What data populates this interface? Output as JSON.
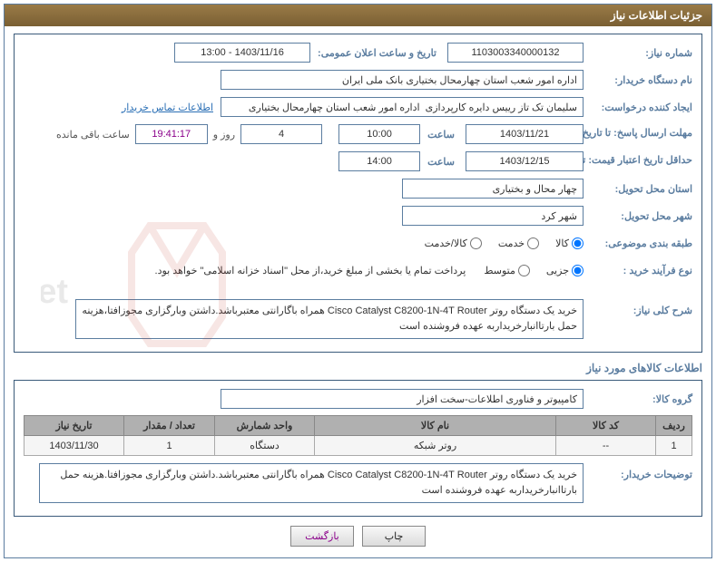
{
  "header_title": "جزئیات اطلاعات نیاز",
  "fields": {
    "need_no_label": "شماره نیاز:",
    "need_no_value": "1103003340000132",
    "announce_label": "تاریخ و ساعت اعلان عمومی:",
    "announce_value": "1403/11/16 - 13:00",
    "buyer_org_label": "نام دستگاه خریدار:",
    "buyer_org_value": "اداره امور شعب استان چهارمحال بختیاری بانک ملی ایران",
    "requester_label": "ایجاد کننده درخواست:",
    "requester_value": "سلیمان تک تاز رییس دایره کارپردازی  اداره امور شعب استان چهارمحال بختیاری",
    "contact_link": "اطلاعات تماس خریدار",
    "response_deadline_label": "مهلت ارسال پاسخ: تا تاریخ:",
    "response_deadline_date": "1403/11/21",
    "saat_label": "ساعت",
    "response_deadline_time": "10:00",
    "days_remaining_value": "4",
    "rooz_va": "روز و",
    "time_remaining_value": "19:41:17",
    "remaining_suffix": "ساعت باقی مانده",
    "price_validity_label": "حداقل تاریخ اعتبار قیمت: تا تاریخ:",
    "price_validity_date": "1403/12/15",
    "price_validity_time": "14:00",
    "delivery_province_label": "استان محل تحویل:",
    "delivery_province_value": "چهار محال و بختیاری",
    "delivery_city_label": "شهر محل تحویل:",
    "delivery_city_value": "شهر کرد",
    "category_label": "طبقه بندی موضوعی:",
    "cat_kala": "کالا",
    "cat_khadamat": "خدمت",
    "cat_kala_khadamat": "کالا/خدمت",
    "process_label": "نوع فرآیند خرید :",
    "proc_jozei": "جزیی",
    "proc_motevaset": "متوسط",
    "payment_note": "پرداخت تمام یا بخشی از مبلغ خرید،از محل \"اسناد خزانه اسلامی\" خواهد بود.",
    "summary_label": "شرح کلی نیاز:",
    "summary_value": "خرید یک دستگاه روتر Cisco Catalyst C8200-1N-4T Router همراه باگارانتی معتبرباشد.داشتن وبارگزاری مجوزافتا،هزینه حمل بارتاانبارخریداربه عهده فروشنده است",
    "goods_info_title": "اطلاعات کالاهای مورد نیاز",
    "group_label": "گروه کالا:",
    "group_value": "کامپیوتر و فناوری اطلاعات-سخت افزار",
    "buyer_desc_label": "توضیحات خریدار:",
    "buyer_desc_value": "خرید یک دستگاه روتر Cisco Catalyst C8200-1N-4T Router همراه باگارانتی معتبرباشد.داشتن وبارگزاری مجوزافتا.هزینه حمل بارتاانبارخریداربه عهده فروشنده است"
  },
  "table": {
    "headers": {
      "row": "ردیف",
      "code": "کد کالا",
      "name": "نام کالا",
      "unit": "واحد شمارش",
      "qty": "تعداد / مقدار",
      "date": "تاریخ نیاز"
    },
    "rows": [
      {
        "row": "1",
        "code": "--",
        "name": "روتر شبکه",
        "unit": "دستگاه",
        "qty": "1",
        "date": "1403/11/30"
      }
    ]
  },
  "buttons": {
    "print": "چاپ",
    "back": "بازگشت"
  }
}
